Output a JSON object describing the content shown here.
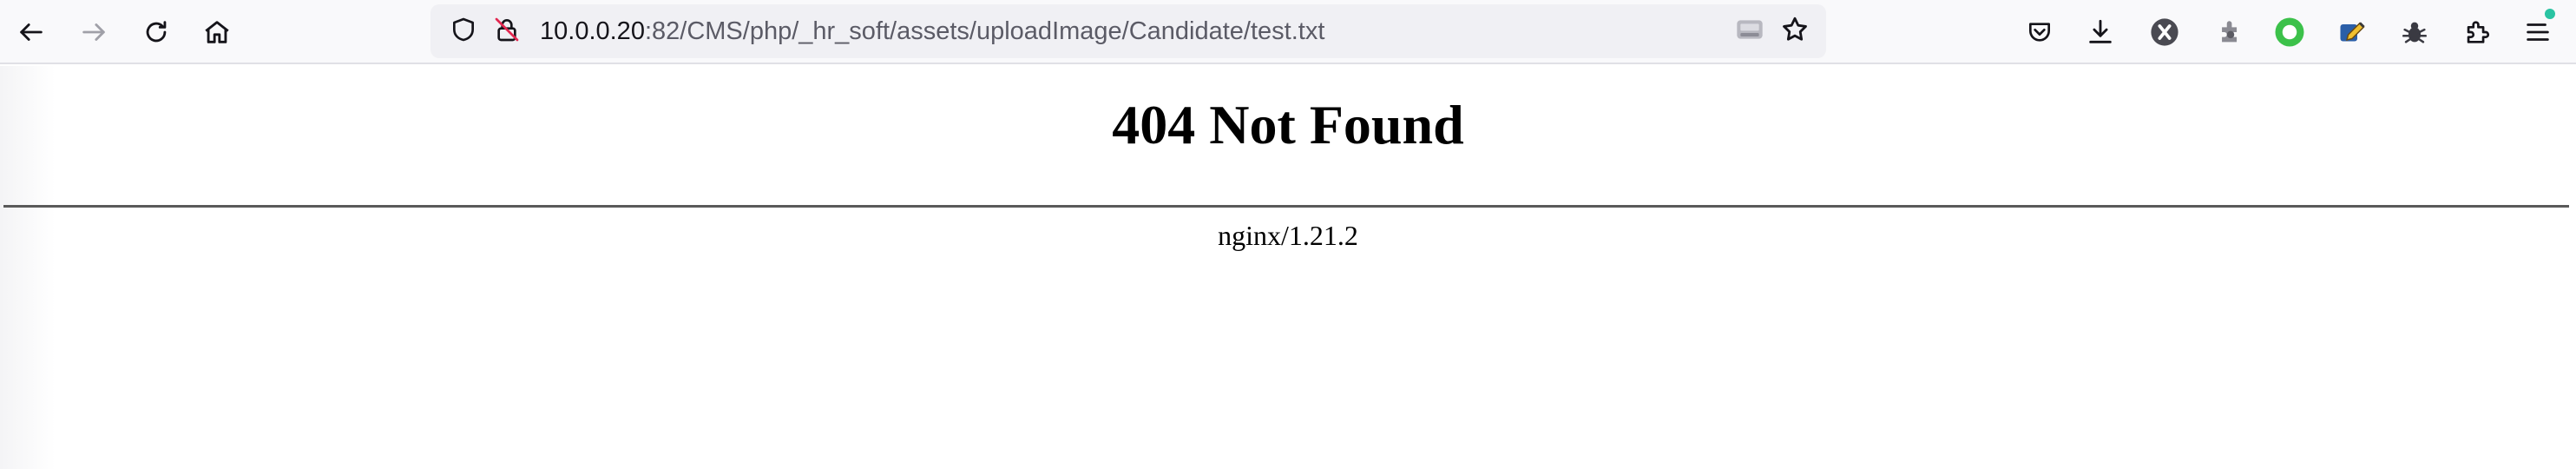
{
  "browser": {
    "url": {
      "host": "10.0.0.20",
      "rest": ":82/CMS/php/_hr_soft/assets/uploadImage/Candidate/test.txt"
    },
    "icons": {
      "back": "back-arrow-icon",
      "forward": "forward-arrow-icon",
      "reload": "reload-icon",
      "home": "home-icon",
      "tracking_protection": "shield-icon",
      "insecure_connection": "insecure-lock-icon",
      "reader_view": "reader-view-icon",
      "bookmark": "star-icon",
      "pocket": "pocket-icon",
      "downloads": "download-icon",
      "extensions": [
        "x-extension-icon",
        "puzzle-bug-extension-icon",
        "green-ring-extension-icon",
        "edit-extension-icon",
        "bug-extension-icon"
      ],
      "extensions_menu": "extensions-puzzle-icon",
      "menu": "hamburger-menu-icon"
    },
    "colors": {
      "toolbar_bg": "#f9f9fb",
      "urlbar_bg": "#f0f0f4",
      "update_badge": "#2ac3a2",
      "icon": "#15141a",
      "icon_disabled": "#a0a0a8"
    }
  },
  "page": {
    "title": "404 Not Found",
    "server_signature": "nginx/1.21.2"
  }
}
